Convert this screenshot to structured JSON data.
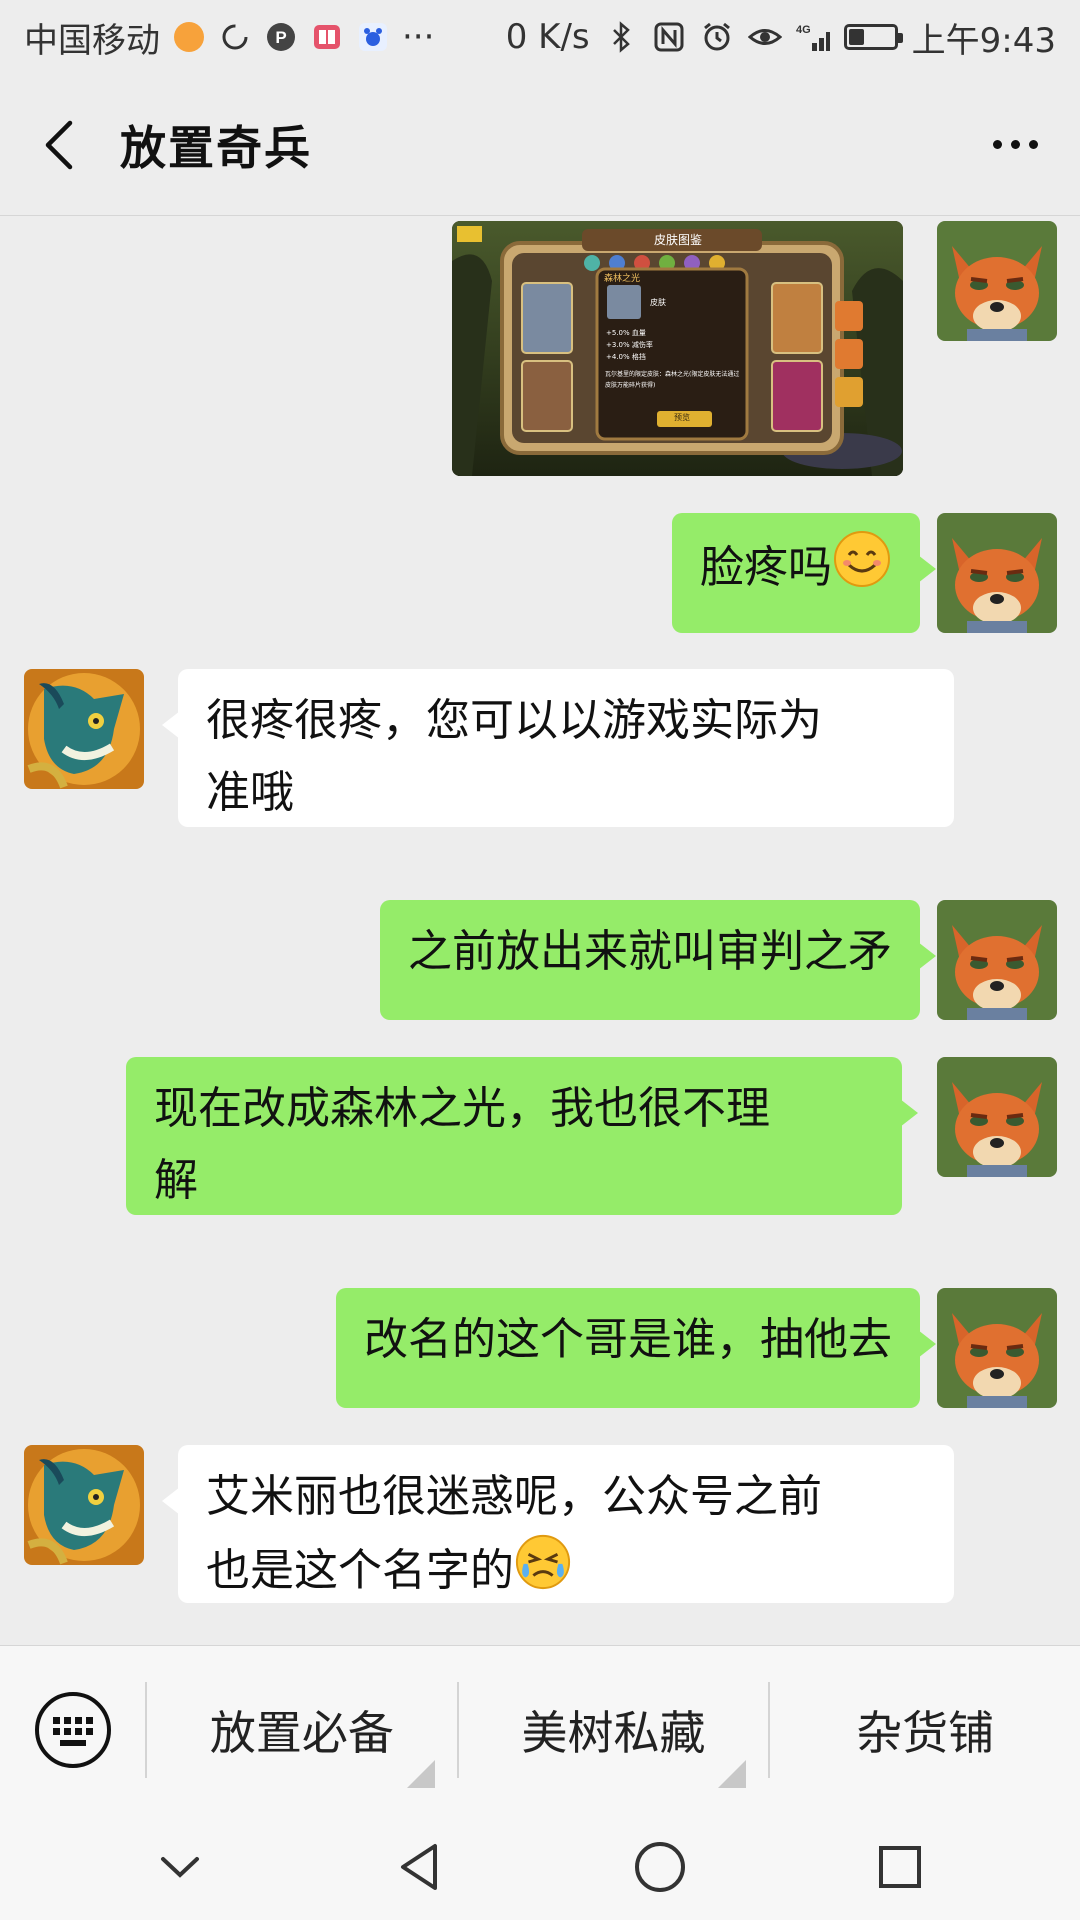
{
  "status_bar": {
    "carrier": "中国移动",
    "network_speed": "0 K/s",
    "time": "上午9:43",
    "battery_level": 0.35,
    "signal": "4G",
    "overflow": "···"
  },
  "header": {
    "title": "放置奇兵",
    "back_icon": "back-arrow-icon",
    "more_icon": "more-dots-icon"
  },
  "game_image": {
    "title": "皮肤图鉴",
    "popup_title": "森林之光",
    "skin_label": "皮肤",
    "stats": [
      "+5.0% 血量",
      "+3.0% 减伤率",
      "+4.0% 格挡"
    ],
    "note": "瓦尔基里的限定皮肤：森林之光(限定皮肤无法通过皮肤万能碎片获得)",
    "button": "预览"
  },
  "messages": [
    {
      "side": "mine",
      "text": "脸疼吗",
      "emoji": "😊"
    },
    {
      "side": "theirs",
      "lines": [
        "很疼很疼，您可以以游戏实际为",
        "准哦"
      ]
    },
    {
      "side": "mine",
      "text": "之前放出来就叫审判之矛"
    },
    {
      "side": "mine",
      "lines": [
        "现在改成森林之光，我也很不理",
        "解"
      ]
    },
    {
      "side": "mine",
      "text": "改名的这个哥是谁，抽他去"
    },
    {
      "side": "theirs",
      "lines": [
        "艾米丽也很迷惑呢，公众号之前",
        "也是这个名字的"
      ],
      "emoji": "😣"
    }
  ],
  "bottom_menu": {
    "items": [
      "放置必备",
      "美树私藏",
      "杂货铺"
    ]
  },
  "colors": {
    "my_bubble": "#95ec69",
    "their_bubble": "#ffffff",
    "background": "#ededed"
  }
}
